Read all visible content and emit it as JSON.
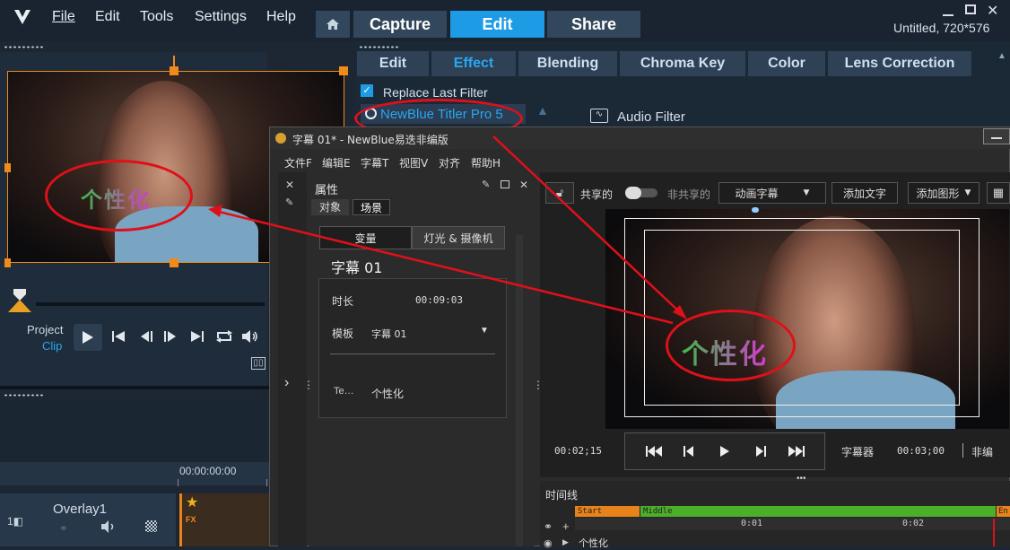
{
  "window": {
    "title": "Untitled, 720*576"
  },
  "menu": [
    "File",
    "Edit",
    "Tools",
    "Settings",
    "Help"
  ],
  "top_tabs": [
    {
      "label": "Capture",
      "active": false
    },
    {
      "label": "Edit",
      "active": true
    },
    {
      "label": "Share",
      "active": false
    }
  ],
  "sub_tabs": [
    {
      "label": "Edit",
      "active": false
    },
    {
      "label": "Effect",
      "active": true
    },
    {
      "label": "Blending",
      "active": false
    },
    {
      "label": "Chroma Key",
      "active": false
    },
    {
      "label": "Color",
      "active": false
    },
    {
      "label": "Lens Correction",
      "active": false
    }
  ],
  "effect_panel": {
    "replace_last_filter": "Replace Last Filter",
    "replace_checked": true,
    "filter_name": "NewBlue Titler Pro 5",
    "audio_filter": "Audio Filter"
  },
  "preview": {
    "title_text": "个性化"
  },
  "player": {
    "project_label": "Project",
    "clip_label": "Clip",
    "timecode": "00:00:00:00"
  },
  "track": {
    "name": "Overlay1"
  },
  "newblue": {
    "title": "字幕 01* - NewBlue易迭非编版",
    "menu": [
      "文件F",
      "编辑E",
      "字幕T",
      "视图V",
      "对齐",
      "帮助H"
    ],
    "props_title": "属性",
    "props_tabs": [
      "对象",
      "场景"
    ],
    "inner_tabs": [
      "变量",
      "灯光 & 摄像机"
    ],
    "caption_name": "字幕 01",
    "duration_label": "时长",
    "duration_value": "00:09:03",
    "template_label": "模板",
    "template_value": "字幕 01",
    "text_label": "Te…",
    "text_value": "个性化",
    "toolbar": {
      "shared": "共享的",
      "unshared": "非共享的",
      "anim": "动画字幕",
      "add_text": "添加文字",
      "add_shape": "添加图形"
    },
    "time_current": "00:02;15",
    "player_mode": "字幕器",
    "time_total": "00:03;00",
    "edit_mode": "非编",
    "timeline_label": "时间线",
    "timeline": {
      "start": "Start",
      "middle": "Middle",
      "end": "En",
      "ticks": [
        "0:01",
        "0:02"
      ],
      "row_text": "个性化"
    }
  },
  "colors": {
    "accent": "#1d9be5",
    "annotation": "#e0101a",
    "start_bar": "#e8821a",
    "middle_bar": "#4caf2a"
  }
}
